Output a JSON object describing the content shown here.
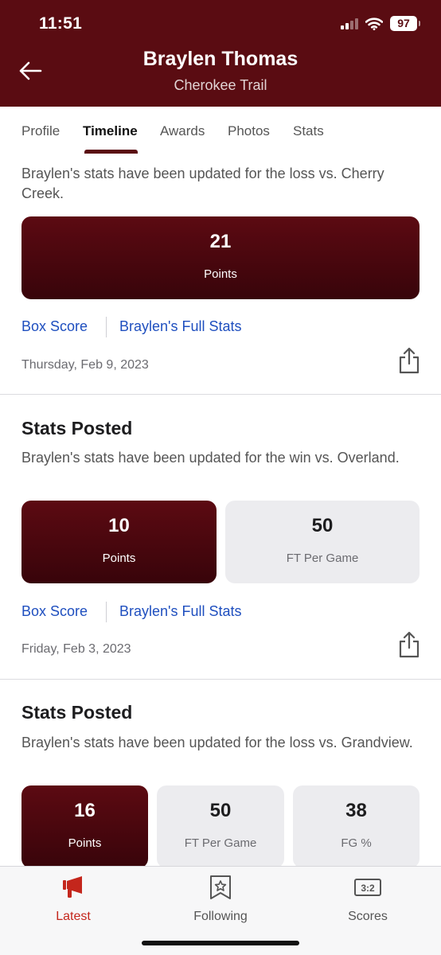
{
  "status_bar": {
    "time": "11:51",
    "battery": "97"
  },
  "header": {
    "title": "Braylen Thomas",
    "subtitle": "Cherokee Trail"
  },
  "tabs": [
    {
      "label": "Profile"
    },
    {
      "label": "Timeline",
      "active": true
    },
    {
      "label": "Awards"
    },
    {
      "label": "Photos"
    },
    {
      "label": "Stats"
    }
  ],
  "feed": [
    {
      "description": "Braylen's stats have been updated for the loss vs. Cherry Creek.",
      "stats": [
        {
          "value": "21",
          "label": "Points"
        }
      ],
      "links": {
        "box_score": "Box Score",
        "full_stats": "Braylen's Full Stats"
      },
      "date": "Thursday, Feb 9, 2023"
    },
    {
      "title": "Stats Posted",
      "description": "Braylen's stats have been updated for the win vs. Overland.",
      "stats": [
        {
          "value": "10",
          "label": "Points"
        },
        {
          "value": "50",
          "label": "FT Per Game"
        }
      ],
      "links": {
        "box_score": "Box Score",
        "full_stats": "Braylen's Full Stats"
      },
      "date": "Friday, Feb 3, 2023"
    },
    {
      "title": "Stats Posted",
      "description": "Braylen's stats have been updated for the loss vs. Grandview.",
      "stats": [
        {
          "value": "16",
          "label": "Points"
        },
        {
          "value": "50",
          "label": "FT Per Game"
        },
        {
          "value": "38",
          "label": "FG %"
        }
      ]
    }
  ],
  "bottom_nav": [
    {
      "label": "Latest",
      "icon": "megaphone-icon",
      "active": true
    },
    {
      "label": "Following",
      "icon": "star-bookmark-icon"
    },
    {
      "label": "Scores",
      "icon": "scoreboard-icon"
    }
  ],
  "colors": {
    "brand": "#5a0c12",
    "link": "#1f4fbf",
    "active_nav": "#c4261c"
  }
}
